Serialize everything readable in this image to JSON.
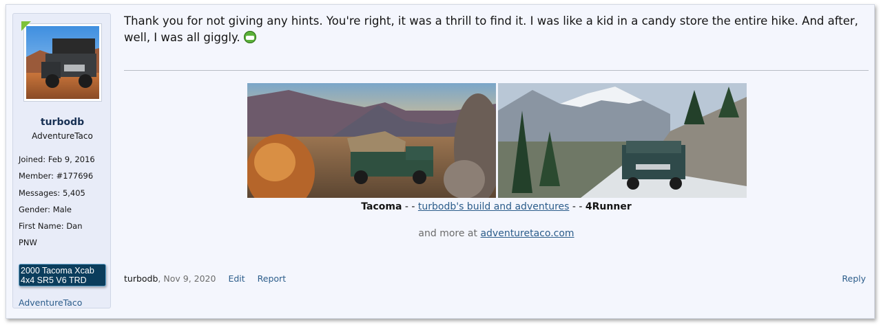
{
  "sidebar": {
    "avatar_alt": "turbodb avatar",
    "username": "turbodb",
    "user_title": "AdventureTaco",
    "stats": [
      {
        "label": "Joined:",
        "value": "Feb 9, 2016"
      },
      {
        "label": "Member:",
        "value": "#177696"
      },
      {
        "label": "Messages:",
        "value": "5,405"
      },
      {
        "label": "Gender:",
        "value": "Male"
      },
      {
        "label": "First Name:",
        "value": "Dan"
      },
      {
        "label": "",
        "value": "PNW"
      }
    ],
    "build_badge_line1": "2000 Tacoma Xcab",
    "build_badge_line2": "4x4 SR5 V6 TRD",
    "link": "AdventureTaco"
  },
  "message": {
    "text": "Thank you for not giving any hints. You're right, it was a thrill to find it. I was like a kid in a candy store the entire hike. And after, well, I was all giggly.",
    "smiley_icon": "grin-smiley-icon"
  },
  "signature": {
    "caption_left": "Tacoma",
    "caption_sep1": " - - ",
    "caption_link": "turbodb's build and adventures",
    "caption_sep2": " - - ",
    "caption_right": "4Runner",
    "more_prefix": "and more at ",
    "more_link": "adventuretaco.com"
  },
  "footer": {
    "author": "turbodb",
    "date": "Nov 9, 2020",
    "edit": "Edit",
    "report": "Report",
    "reply": "Reply"
  },
  "colors": {
    "post_bg": "#f4f6fd",
    "sidebar_bg": "#e8ecf8",
    "link": "#2b5c8a",
    "badge_bg": "#0b3d5c"
  }
}
